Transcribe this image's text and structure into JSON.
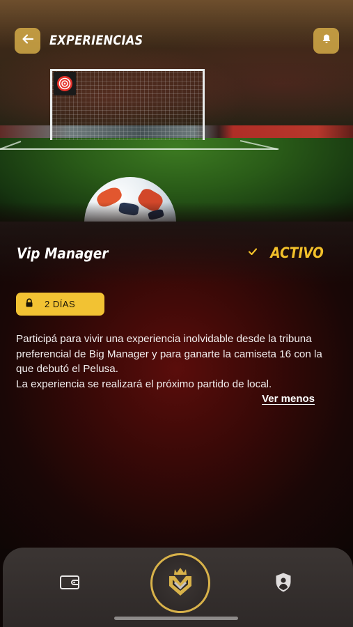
{
  "header": {
    "title": "EXPERIENCIAS",
    "back_icon": "arrow-left-icon",
    "notifications_icon": "bell-icon"
  },
  "experience": {
    "title": "Vip Manager",
    "status_label": "ACTIVO",
    "status_icon": "check-icon",
    "days_badge": "2 DÍAS",
    "days_icon": "lock-icon",
    "description": [
      "Participá para vivir una experiencia inolvidable desde la tribuna preferencial de Big Manager y para ganarte la camiseta 16 con la que debutó el Pelusa.",
      "La experiencia se realizará el próximo partido de local."
    ],
    "toggle_label": "Ver menos"
  },
  "bottom_nav": {
    "items": [
      {
        "name": "wallet",
        "icon": "wallet-icon"
      },
      {
        "name": "home",
        "icon": "manager-logo-icon"
      },
      {
        "name": "profile",
        "icon": "shield-user-icon"
      }
    ]
  },
  "colors": {
    "accent_gold": "#f2c233",
    "button_gold": "#d4aa48",
    "status_yellow": "#f2c02a"
  }
}
